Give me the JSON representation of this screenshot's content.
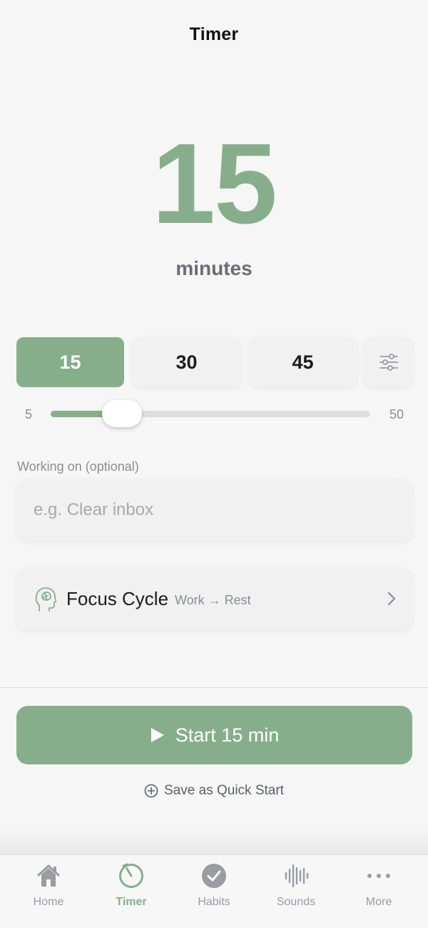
{
  "header": {
    "title": "Timer"
  },
  "timer": {
    "value": "15",
    "unit": "minutes"
  },
  "presets": [
    {
      "label": "15",
      "active": true
    },
    {
      "label": "30",
      "active": false
    },
    {
      "label": "45",
      "active": false
    }
  ],
  "settings_icon": "sliders-icon",
  "slider": {
    "min": 5,
    "max": 50,
    "value": 15,
    "min_label": "5",
    "max_label": "50"
  },
  "working_on": {
    "label": "Working on (optional)",
    "placeholder": "e.g. Clear inbox",
    "value": ""
  },
  "focus_cycle": {
    "icon": "brain-head-icon",
    "title": "Focus Cycle",
    "subtitle": "Work → Rest"
  },
  "start_button": {
    "label": "Start 15 min",
    "icon": "play-icon"
  },
  "save_quick_start": {
    "label": "Save as Quick Start",
    "icon": "plus-circle-icon"
  },
  "tab_bar": [
    {
      "label": "Home",
      "icon": "home-icon",
      "active": false
    },
    {
      "label": "Timer",
      "icon": "timer-icon",
      "active": true
    },
    {
      "label": "Habits",
      "icon": "checkmark-circle-icon",
      "active": false
    },
    {
      "label": "Sounds",
      "icon": "waveform-icon",
      "active": false
    },
    {
      "label": "More",
      "icon": "ellipsis-icon",
      "active": false
    }
  ],
  "colors": {
    "accent": "#87ae8b",
    "background": "#f6f6f6",
    "card": "#f1f1f2",
    "muted_text": "#8b8e94",
    "tab_inactive": "#9a9ca2"
  }
}
